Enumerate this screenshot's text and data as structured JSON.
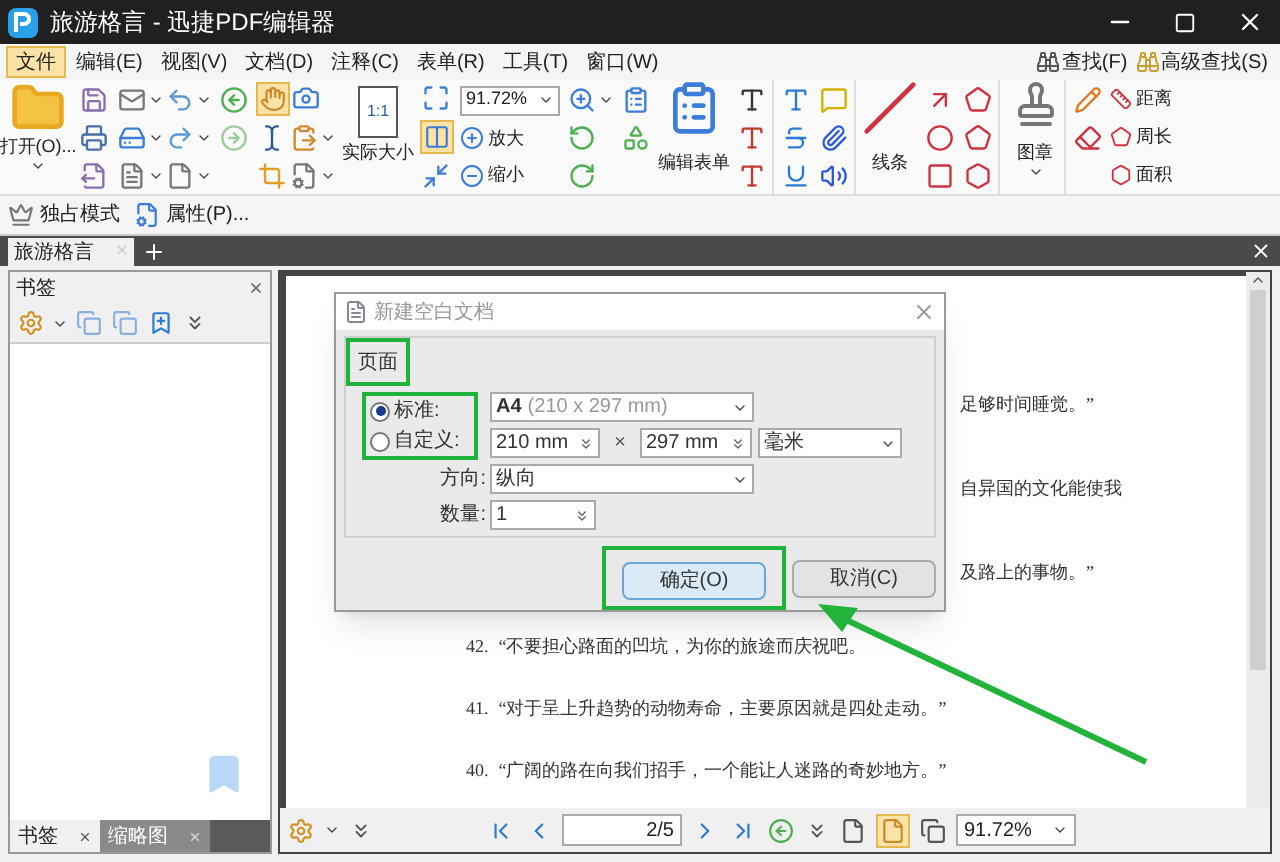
{
  "window": {
    "title": "旅游格言 - 迅捷PDF编辑器"
  },
  "menu": [
    {
      "label": "文件",
      "selected": true
    },
    {
      "label": "编辑(E)",
      "selected": false
    },
    {
      "label": "视图(V)",
      "selected": false
    },
    {
      "label": "文档(D)",
      "selected": false
    },
    {
      "label": "注释(C)",
      "selected": false
    },
    {
      "label": "表单(R)",
      "selected": false
    },
    {
      "label": "工具(T)",
      "selected": false
    },
    {
      "label": "窗口(W)",
      "selected": false
    }
  ],
  "search_buttons": [
    "查找(F)",
    "高级查找(S)"
  ],
  "ribbon": {
    "open": "打开(O)...",
    "actual_size": "实际大小",
    "actual_size_icon": "1:1",
    "zoom": "91.72%",
    "zoom_in": "放大",
    "zoom_out": "缩小",
    "edit_form": "编辑表单",
    "lines": "线条",
    "stamp": "图章",
    "measure": [
      "距离",
      "周长",
      "面积"
    ]
  },
  "toolbar": [
    "独占模式",
    "属性(P)..."
  ],
  "doc_tabs": [
    {
      "label": "旅游格言",
      "selected": true
    }
  ],
  "bookmark_panel": {
    "title": "书签",
    "tabs": [
      {
        "label": "书签",
        "selected": true
      },
      {
        "label": "缩略图",
        "selected": false
      }
    ]
  },
  "document": {
    "lines": [
      {
        "kind": "partial",
        "text": "足够时间睡觉。”"
      },
      {
        "kind": "partial",
        "text": "自异国的文化能使我"
      },
      {
        "kind": "partial",
        "text": "及路上的事物。”"
      },
      {
        "kind": "item",
        "number": "42.",
        "text": "“不要担心路面的凹坑，为你的旅途而庆祝吧。"
      },
      {
        "kind": "item",
        "number": "41.",
        "text": "“对于呈上升趋势的动物寿命，主要原因就是四处走动。”"
      },
      {
        "kind": "item",
        "number": "40.",
        "text": "“广阔的路在向我们招手，一个能让人迷路的奇妙地方。”"
      }
    ]
  },
  "dialog": {
    "title": "新建空白文档",
    "group": "页面",
    "size_options": [
      {
        "label": "标准:",
        "selected": true
      },
      {
        "label": "自定义:",
        "selected": false
      }
    ],
    "standard_size": "A4",
    "standard_size_detail": "(210 x 297 mm)",
    "width": "210 mm",
    "times": "×",
    "height": "297 mm",
    "unit": "毫米",
    "orientation_label": "方向:",
    "orientation": "纵向",
    "count_label": "数量:",
    "count": "1",
    "buttons": [
      {
        "label": "确定(O)",
        "default": true
      },
      {
        "label": "取消(C)",
        "default": false
      }
    ]
  },
  "nav": {
    "page": "2/5",
    "zoom": "91.72%"
  }
}
